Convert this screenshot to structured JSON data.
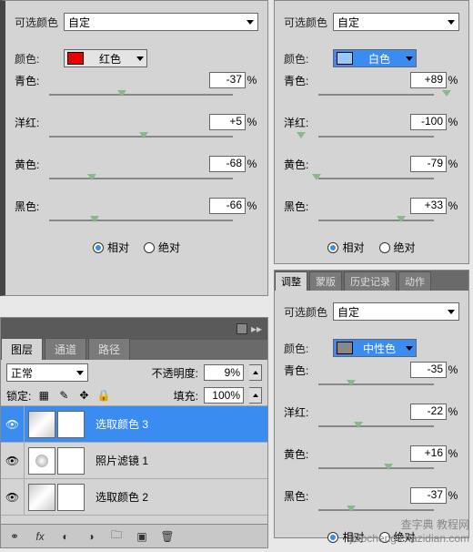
{
  "panel1": {
    "selectable_title": "可选颜色",
    "preset": "自定",
    "color_label": "颜色:",
    "color_name": "红色",
    "sliders": {
      "cyan": {
        "label": "青色:",
        "value": "-37",
        "pct": "%"
      },
      "magenta": {
        "label": "洋红:",
        "value": "+5",
        "pct": "%"
      },
      "yellow": {
        "label": "黄色:",
        "value": "-68",
        "pct": "%"
      },
      "black": {
        "label": "黑色:",
        "value": "-66",
        "pct": "%"
      }
    },
    "relative": "相对",
    "absolute": "绝对"
  },
  "panel2": {
    "selectable_title": "可选颜色",
    "preset": "自定",
    "color_label": "颜色:",
    "color_name": "白色",
    "sliders": {
      "cyan": {
        "label": "青色:",
        "value": "+89",
        "pct": "%"
      },
      "magenta": {
        "label": "洋红:",
        "value": "-100",
        "pct": "%"
      },
      "yellow": {
        "label": "黄色:",
        "value": "-79",
        "pct": "%"
      },
      "black": {
        "label": "黑色:",
        "value": "+33",
        "pct": "%"
      }
    },
    "relative": "相对",
    "absolute": "绝对"
  },
  "panel3": {
    "tabs": [
      "调整",
      "蒙版",
      "历史记录",
      "动作"
    ],
    "selectable_title": "可选颜色",
    "preset": "自定",
    "color_label": "颜色:",
    "color_name": "中性色",
    "sliders": {
      "cyan": {
        "label": "青色:",
        "value": "-35",
        "pct": "%"
      },
      "magenta": {
        "label": "洋红:",
        "value": "-22",
        "pct": "%"
      },
      "yellow": {
        "label": "黄色:",
        "value": "+16",
        "pct": "%"
      },
      "black": {
        "label": "黑色:",
        "value": "-37",
        "pct": "%"
      }
    },
    "relative": "相对",
    "absolute": "绝对"
  },
  "layers": {
    "tabs": [
      "图层",
      "通道",
      "路径"
    ],
    "blend": "正常",
    "opacity_label": "不透明度:",
    "opacity_value": "9%",
    "lock_label": "锁定:",
    "fill_label": "填充:",
    "fill_value": "100%",
    "items": [
      {
        "name": "选取颜色 3",
        "selected": true,
        "type": "adj"
      },
      {
        "name": "照片滤镜 1",
        "selected": false,
        "type": "pf"
      },
      {
        "name": "选取颜色 2",
        "selected": false,
        "type": "adj"
      }
    ]
  },
  "watermark": {
    "l1": "查字典 教程网",
    "l2": "jiaocheng.chazidian.com"
  }
}
